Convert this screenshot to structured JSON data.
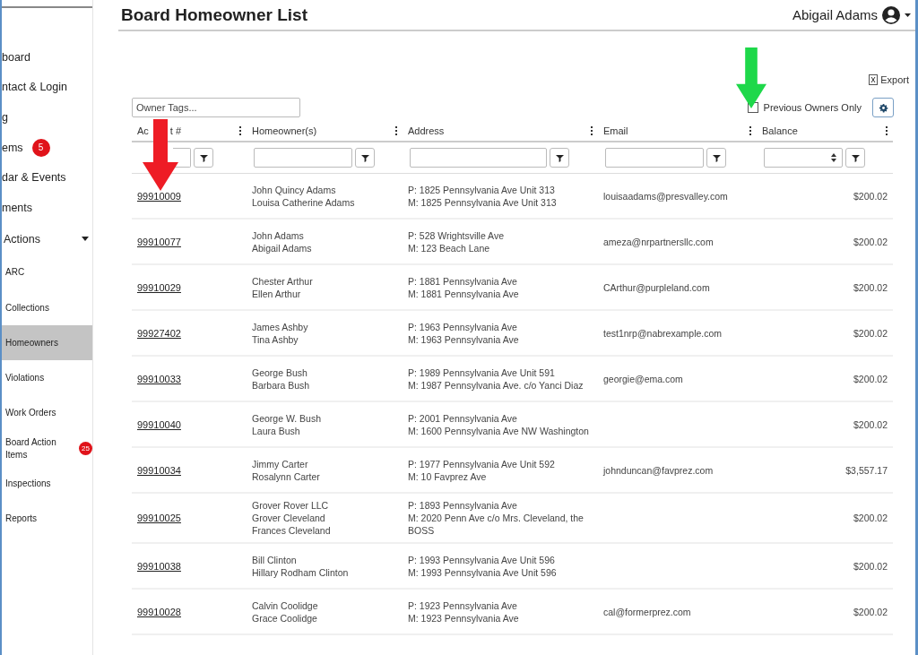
{
  "sidebar": {
    "items": [
      {
        "label": "board",
        "selected": false,
        "kind": "top"
      },
      {
        "label": "ntact & Login",
        "selected": false,
        "kind": "top"
      },
      {
        "label": "g",
        "selected": false,
        "kind": "top"
      },
      {
        "label": "ems",
        "selected": false,
        "kind": "top",
        "badge": "5"
      },
      {
        "label": "dar & Events",
        "selected": false,
        "kind": "top"
      },
      {
        "label": "ments",
        "selected": false,
        "kind": "top"
      },
      {
        "label": "Actions",
        "selected": false,
        "kind": "group",
        "expanded": true
      },
      {
        "label": "ARC",
        "selected": false,
        "kind": "sub"
      },
      {
        "label": "Collections",
        "selected": false,
        "kind": "sub"
      },
      {
        "label": "Homeowners",
        "selected": true,
        "kind": "sub"
      },
      {
        "label": "Violations",
        "selected": false,
        "kind": "sub"
      },
      {
        "label": "Work Orders",
        "selected": false,
        "kind": "sub"
      },
      {
        "label": "Board Action Items",
        "selected": false,
        "kind": "sub",
        "badge": "25"
      },
      {
        "label": "Inspections",
        "selected": false,
        "kind": "sub"
      },
      {
        "label": "Reports",
        "selected": false,
        "kind": "sub"
      }
    ]
  },
  "header": {
    "title": "Board Homeowner List",
    "user": "Abigail Adams"
  },
  "toolbar": {
    "export": "Export",
    "tags_placeholder": "Owner Tags...",
    "previous_owners": {
      "label": "Previous Owners Only",
      "checked": false
    }
  },
  "table": {
    "columns": [
      [
        "Ac",
        "t #"
      ],
      [
        "Homeowner(s)"
      ],
      [
        "Address"
      ],
      [
        "Email"
      ],
      [
        "Balance"
      ]
    ],
    "rows": [
      {
        "account": "99910009",
        "owners": [
          "John Quincy Adams",
          "Louisa Catherine Adams"
        ],
        "address": [
          "P: 1825 Pennsylvania Ave Unit 313",
          "M: 1825 Pennsylvania Ave Unit 313"
        ],
        "email": "louisaadams@presvalley.com",
        "balance": "$200.02"
      },
      {
        "account": "99910077",
        "owners": [
          "John Adams",
          "Abigail Adams"
        ],
        "address": [
          "P: 528 Wrightsville Ave",
          "M: 123 Beach Lane"
        ],
        "email": "ameza@nrpartnersllc.com",
        "balance": "$200.02"
      },
      {
        "account": "99910029",
        "owners": [
          "Chester Arthur",
          "Ellen Arthur"
        ],
        "address": [
          "P: 1881 Pennsylvania Ave",
          "M: 1881 Pennsylvania Ave"
        ],
        "email": "CArthur@purpleland.com",
        "balance": "$200.02"
      },
      {
        "account": "99927402",
        "owners": [
          "James Ashby",
          "Tina Ashby"
        ],
        "address": [
          "P: 1963 Pennsylvania Ave",
          "M: 1963 Pennsylvania Ave"
        ],
        "email": "test1nrp@nabrexample.com",
        "balance": "$200.02"
      },
      {
        "account": "99910033",
        "owners": [
          "George Bush",
          "Barbara Bush"
        ],
        "address": [
          "P: 1989 Pennsylvania Ave Unit 591",
          "M: 1987 Pennsylvania Ave. c/o Yanci Diaz"
        ],
        "email": "georgie@ema.com",
        "balance": "$200.02"
      },
      {
        "account": "99910040",
        "owners": [
          "George W. Bush",
          "Laura Bush"
        ],
        "address": [
          "P: 2001 Pennsylvania Ave",
          "M: 1600 Pennsylvania Ave NW Washington"
        ],
        "balance": "$200.02"
      },
      {
        "account": "99910034",
        "owners": [
          "Jimmy Carter",
          "Rosalynn Carter"
        ],
        "address": [
          "P: 1977 Pennsylvania Ave Unit 592",
          "M: 10 Favprez Ave"
        ],
        "email": "johnduncan@favprez.com",
        "balance": "$3,557.17"
      },
      {
        "account": "99910025",
        "owners": [
          "Grover Rover LLC",
          "Grover Cleveland",
          "Frances Cleveland"
        ],
        "address": [
          "P: 1893 Pennsylvania Ave",
          "M: 2020 Penn Ave c/o Mrs. Cleveland, the BOSS"
        ],
        "balance": "$200.02"
      },
      {
        "account": "99910038",
        "owners": [
          "Bill Clinton",
          "Hillary Rodham Clinton"
        ],
        "address": [
          "P: 1993 Pennsylvania Ave Unit 596",
          "M: 1993 Pennsylvania Ave Unit 596"
        ],
        "balance": "$200.02"
      },
      {
        "account": "99910028",
        "owners": [
          "Calvin Coolidge",
          "Grace Coolidge"
        ],
        "address": [
          "P: 1923 Pennsylvania Ave",
          "M: 1923 Pennsylvania Ave"
        ],
        "email": "cal@formerprez.com",
        "balance": "$200.02"
      }
    ]
  },
  "annotations": [
    {
      "kind": "arrow",
      "color": "#ee1c25"
    },
    {
      "kind": "arrow",
      "color": "#1ed84a"
    }
  ]
}
